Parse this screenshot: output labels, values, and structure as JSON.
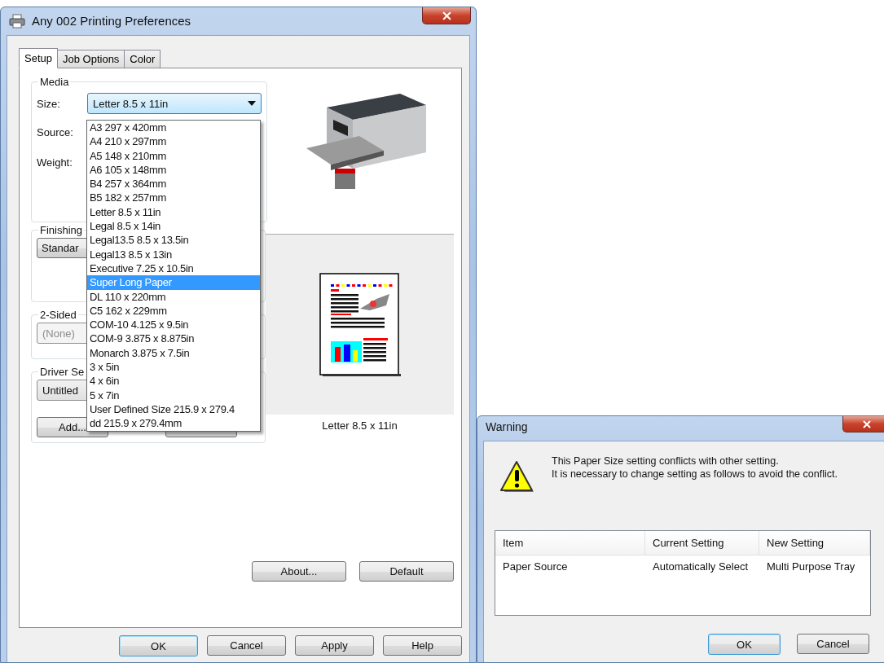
{
  "main_window": {
    "title": "Any 002 Printing Preferences",
    "tabs": [
      {
        "label": "Setup",
        "selected": true
      },
      {
        "label": "Job Options",
        "selected": false
      },
      {
        "label": "Color",
        "selected": false
      }
    ],
    "media": {
      "legend": "Media",
      "size_label": "Size:",
      "size_value": "Letter 8.5 x 11in",
      "source_label": "Source:",
      "weight_label": "Weight:"
    },
    "size_list": [
      {
        "label": "A3 297 x 420mm",
        "selected": false
      },
      {
        "label": "A4 210 x 297mm",
        "selected": false
      },
      {
        "label": "A5 148 x 210mm",
        "selected": false
      },
      {
        "label": "A6 105 x 148mm",
        "selected": false
      },
      {
        "label": "B4 257 x 364mm",
        "selected": false
      },
      {
        "label": "B5 182 x 257mm",
        "selected": false
      },
      {
        "label": "Letter 8.5 x 11in",
        "selected": false
      },
      {
        "label": "Legal 8.5 x 14in",
        "selected": false
      },
      {
        "label": "Legal13.5 8.5 x 13.5in",
        "selected": false
      },
      {
        "label": "Legal13 8.5 x 13in",
        "selected": false
      },
      {
        "label": "Executive 7.25 x 10.5in",
        "selected": false
      },
      {
        "label": "Super Long Paper",
        "selected": true
      },
      {
        "label": "DL 110 x 220mm",
        "selected": false
      },
      {
        "label": "C5 162 x 229mm",
        "selected": false
      },
      {
        "label": "COM-10 4.125 x 9.5in",
        "selected": false
      },
      {
        "label": "COM-9 3.875 x 8.875in",
        "selected": false
      },
      {
        "label": "Monarch 3.875 x 7.5in",
        "selected": false
      },
      {
        "label": "3 x 5in",
        "selected": false
      },
      {
        "label": "4 x 6in",
        "selected": false
      },
      {
        "label": "5 x 7in",
        "selected": false
      },
      {
        "label": "User Defined Size 215.9 x 279.4",
        "selected": false
      },
      {
        "label": "dd 215.9 x 279.4mm",
        "selected": false
      }
    ],
    "finishing": {
      "legend": "Finishing",
      "button": "Standar"
    },
    "two_sided": {
      "legend": "2-Sided",
      "value": "(None)",
      "disabled": true
    },
    "driver_settings": {
      "legend": "Driver Se",
      "value": "Untitled",
      "add_button": "Add..."
    },
    "preview_caption": "Letter 8.5 x 11in",
    "panel_buttons": [
      "About...",
      "Default"
    ],
    "buttons": [
      {
        "label": "OK",
        "default": true
      },
      {
        "label": "Cancel",
        "default": false
      },
      {
        "label": "Apply",
        "default": false
      },
      {
        "label": "Help",
        "default": false
      }
    ]
  },
  "warning_dialog": {
    "title": "Warning",
    "message": [
      "This Paper Size setting conflicts with other setting.",
      "It is necessary to change setting as follows to avoid the conflict."
    ],
    "table": {
      "columns": [
        "Item",
        "Current Setting",
        "New Setting"
      ],
      "rows": [
        [
          "Paper Source",
          "Automatically Select",
          "Multi Purpose Tray"
        ]
      ]
    },
    "buttons": [
      {
        "label": "OK",
        "default": true
      },
      {
        "label": "Cancel",
        "default": false
      }
    ]
  }
}
